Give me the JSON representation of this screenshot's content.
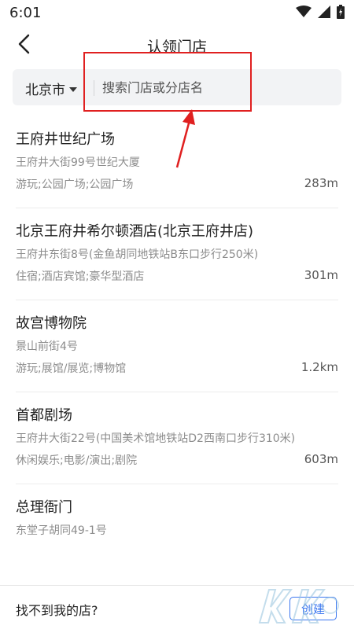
{
  "status_bar": {
    "time": "6:01",
    "icons": [
      "wifi-icon",
      "signal-icon",
      "battery-icon"
    ]
  },
  "header": {
    "title": "认领门店",
    "back_icon": "back-arrow-icon"
  },
  "search": {
    "city": "北京市",
    "placeholder": "搜索门店或分店名"
  },
  "stores": [
    {
      "name": "王府井世纪广场",
      "address": "王府井大街99号世纪大厦",
      "category": "游玩;公园广场;公园广场",
      "distance": "283m"
    },
    {
      "name": "北京王府井希尔顿酒店(北京王府井店)",
      "address": "王府井东街8号(金鱼胡同地铁站B东口步行250米)",
      "category": "住宿;酒店宾馆;豪华型酒店",
      "distance": "301m"
    },
    {
      "name": "故宫博物院",
      "address": "景山前街4号",
      "category": "游玩;展馆/展览;博物馆",
      "distance": "1.2km"
    },
    {
      "name": "首都剧场",
      "address": "王府井大街22号(中国美术馆地铁站D2西南口步行310米)",
      "category": "休闲娱乐;电影/演出;剧院",
      "distance": "603m"
    },
    {
      "name": "总理衙门",
      "address": "东堂子胡同49-1号",
      "category": "",
      "distance": ""
    }
  ],
  "footer": {
    "prompt": "找不到我的店?",
    "create_label": "创建"
  },
  "annotation": {
    "box_color": "#e02020"
  },
  "colors": {
    "accent": "#3a76f0",
    "search_bg": "#f2f3f5",
    "secondary_text": "#8c8c8c"
  }
}
